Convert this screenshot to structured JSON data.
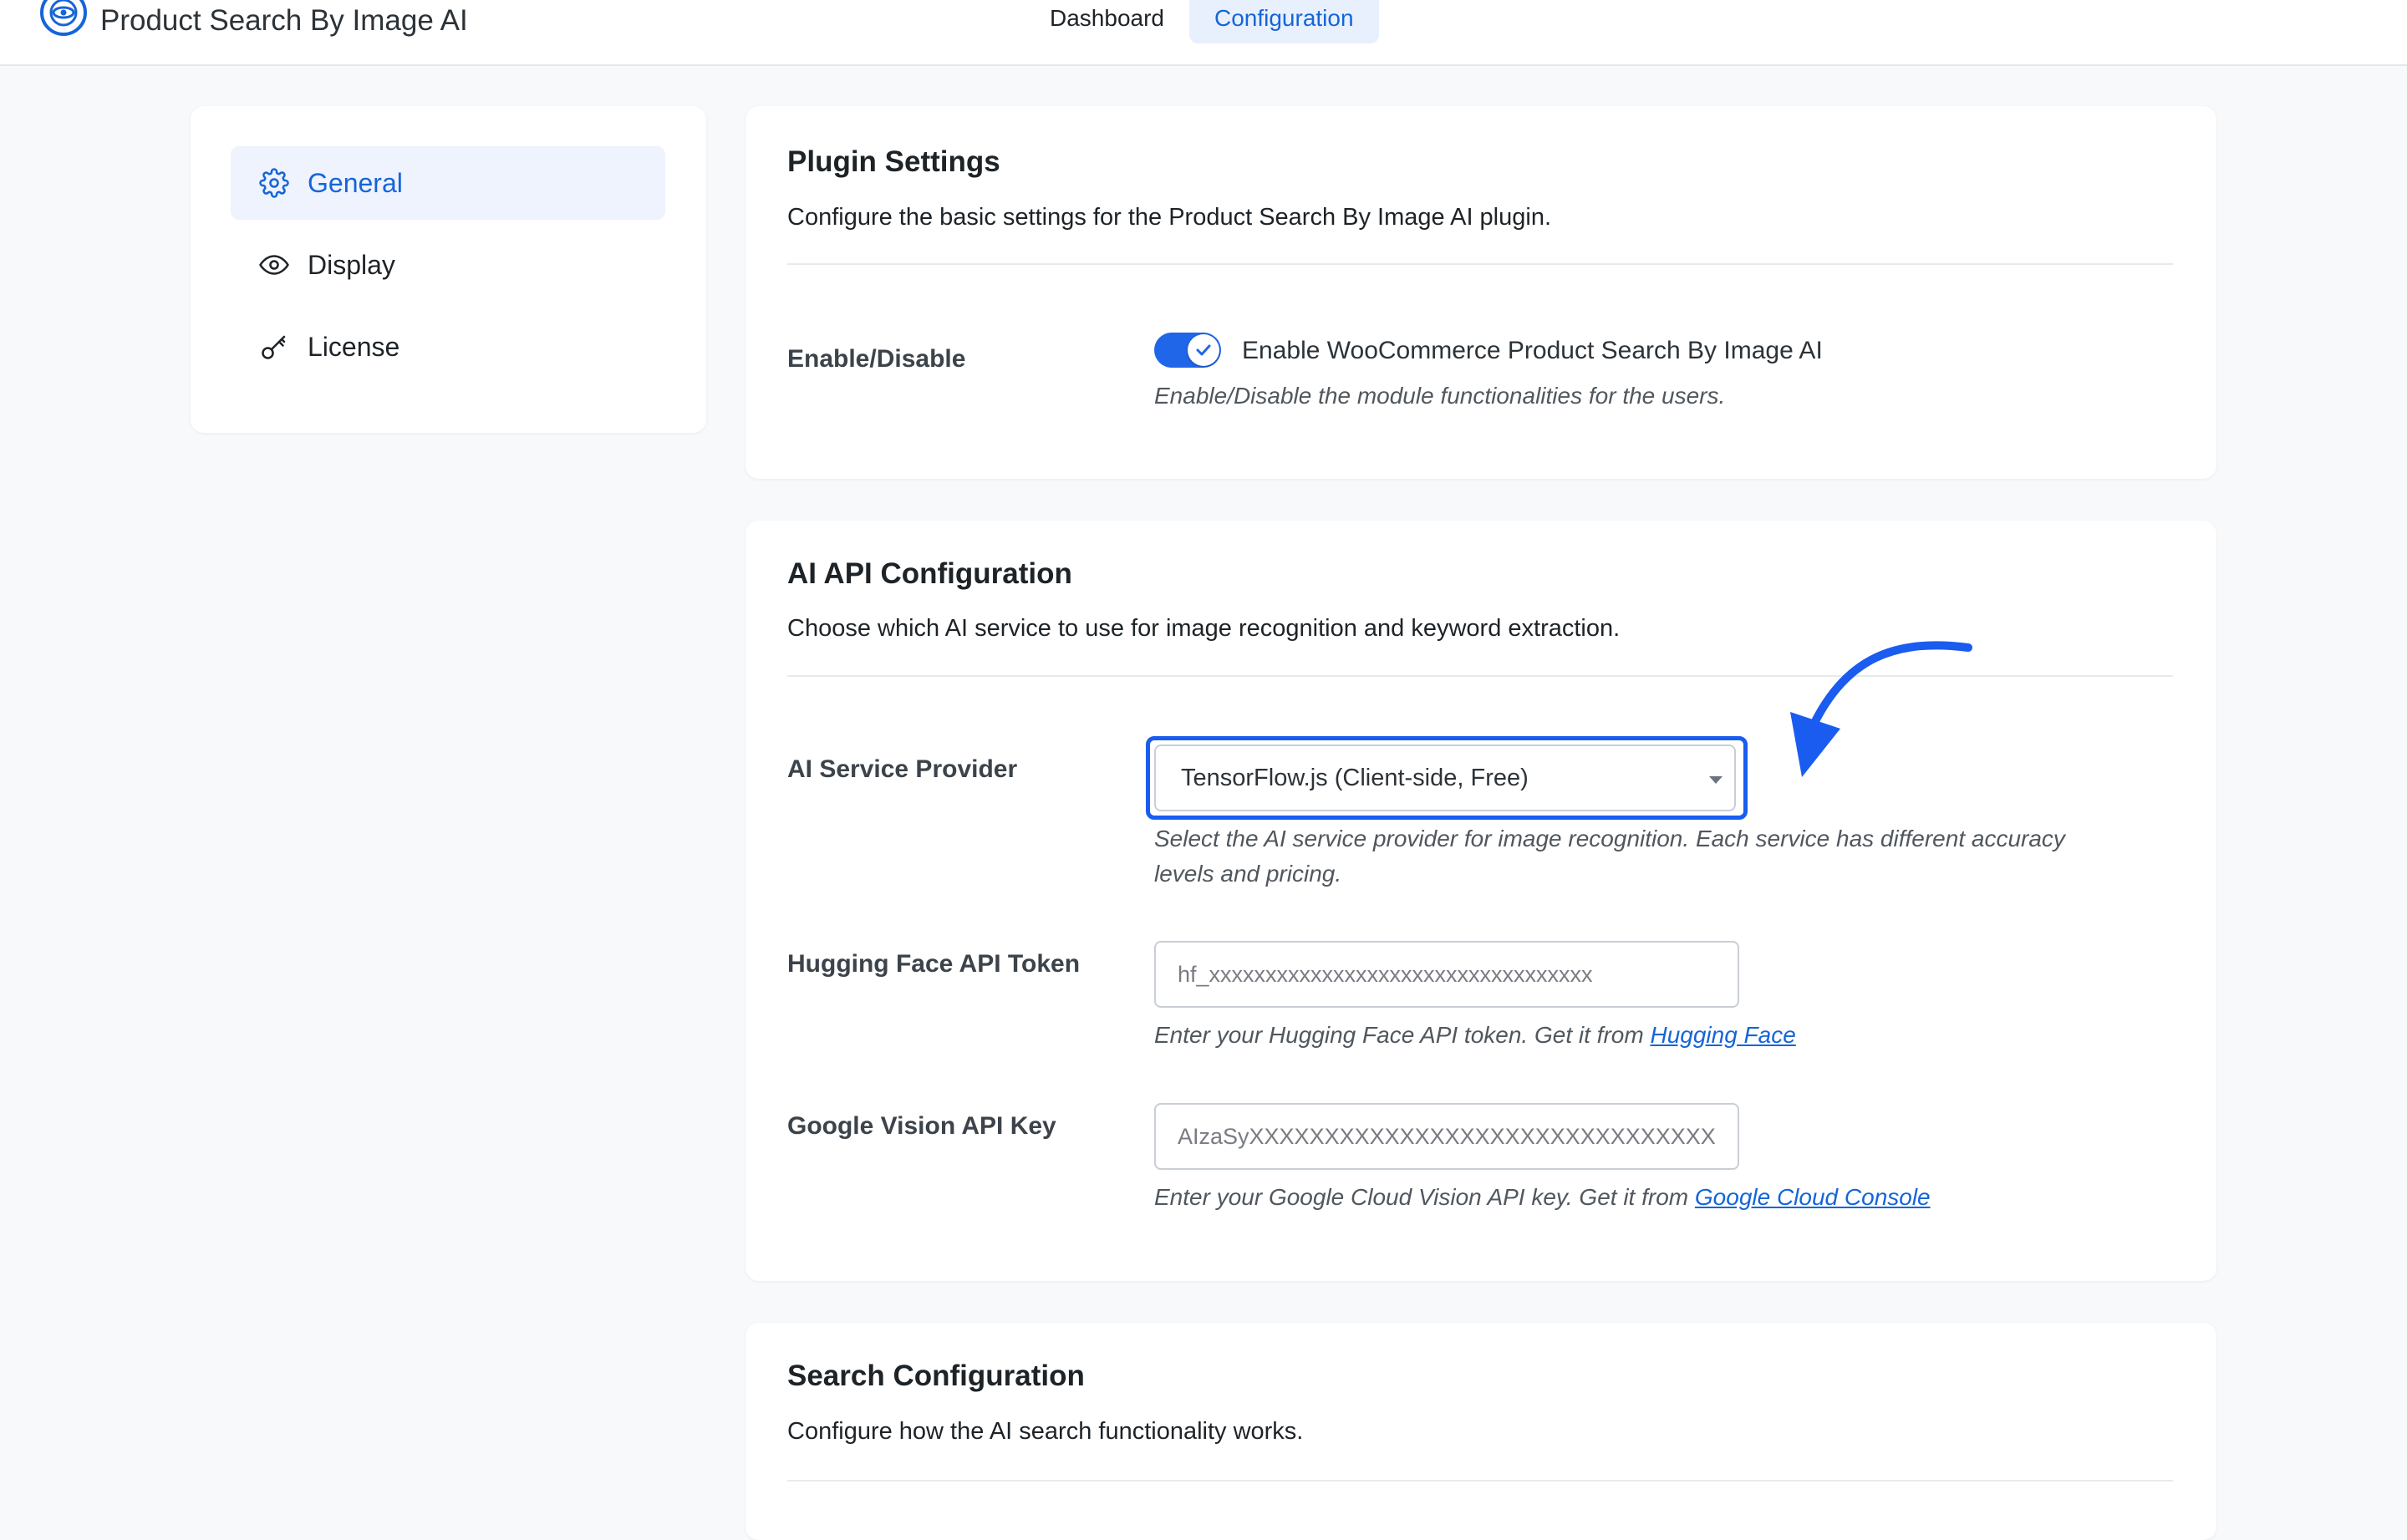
{
  "header": {
    "brand_title": "Product Search By Image AI",
    "nav": [
      {
        "label": "Dashboard",
        "active": false
      },
      {
        "label": "Configuration",
        "active": true
      }
    ]
  },
  "sidebar": {
    "items": [
      {
        "label": "General",
        "icon": "gear-icon",
        "active": true
      },
      {
        "label": "Display",
        "icon": "eye-icon",
        "active": false
      },
      {
        "label": "License",
        "icon": "key-icon",
        "active": false
      }
    ]
  },
  "plugin_settings": {
    "title": "Plugin Settings",
    "description": "Configure the basic settings for the Product Search By Image AI plugin.",
    "enable_label": "Enable/Disable",
    "toggle_text": "Enable WooCommerce Product Search By Image AI",
    "toggle_on": true,
    "help": "Enable/Disable the module functionalities for the users."
  },
  "ai_api": {
    "title": "AI API Configuration",
    "description": "Choose which AI service to use for image recognition and keyword extraction.",
    "provider_label": "AI Service Provider",
    "provider_value": "TensorFlow.js (Client-side, Free)",
    "provider_help_line1": "Select the AI service provider for image recognition. Each service has different accuracy",
    "provider_help_line2": "levels and pricing.",
    "hf_label": "Hugging Face API Token",
    "hf_placeholder": "hf_xxxxxxxxxxxxxxxxxxxxxxxxxxxxxxxxxx",
    "hf_help": "Enter your Hugging Face API token. Get it from ",
    "hf_link": "Hugging Face",
    "gv_label": "Google Vision API Key",
    "gv_placeholder": "AIzaSyXXXXXXXXXXXXXXXXXXXXXXXXXXXXXXX",
    "gv_help": "Enter your Google Cloud Vision API key. Get it from ",
    "gv_link": "Google Cloud Console"
  },
  "search_config": {
    "title": "Search Configuration",
    "description": "Configure how the AI search functionality works."
  },
  "colors": {
    "accent": "#1565d8",
    "annotation": "#1a5cf0",
    "toggle_on": "#2066e8"
  }
}
